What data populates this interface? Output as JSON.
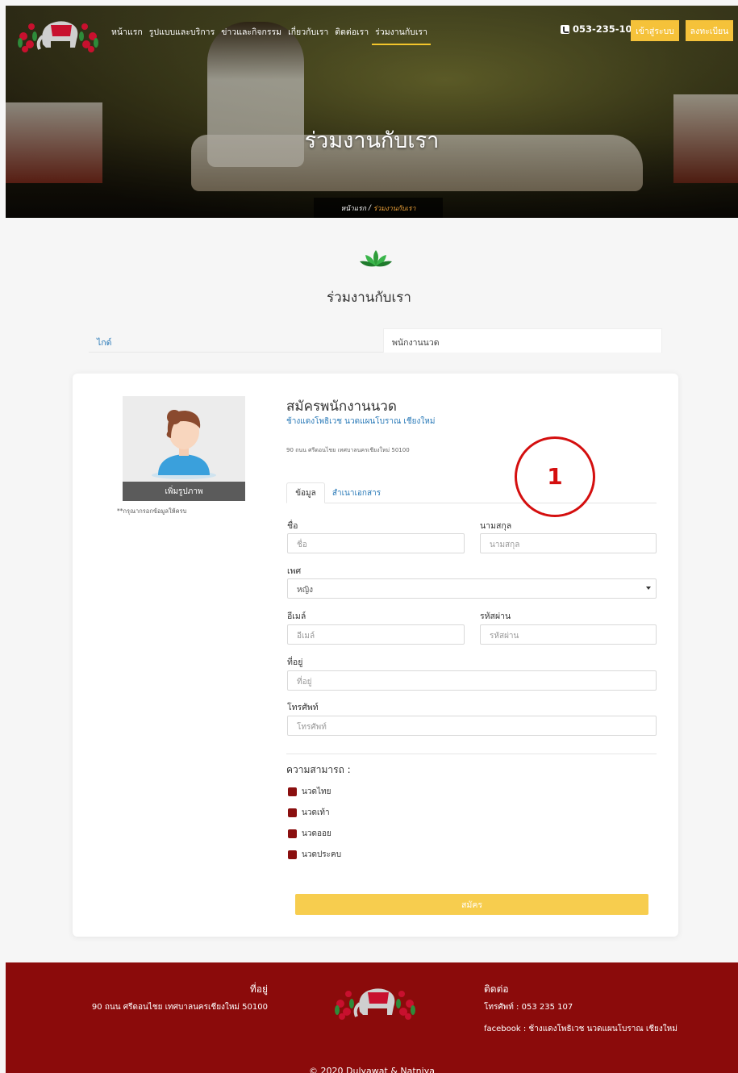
{
  "nav": {
    "menu": [
      "หน้าแรก",
      "รูปแบบและบริการ",
      "ข่าวและกิจกรรม",
      "เกี่ยวกับเรา",
      "ติดต่อเรา",
      "ร่วมงานกับเรา"
    ],
    "phone": "053-235-107",
    "login": "เข้าสู่ระบบ",
    "register": "ลงทะเบียน"
  },
  "hero": {
    "title": "ร่วมงานกับเรา",
    "crumb_home": "หน้าแรก",
    "crumb_sep": "/",
    "crumb_current": "ร่วมงานกับเรา"
  },
  "section": {
    "title": "ร่วมงานกับเรา",
    "filter_left": "ไกด์",
    "filter_right": "พนักงานนวด"
  },
  "form": {
    "add_photo": "เพิ่มรูปภาพ",
    "note": "**กรุณากรอกข้อมูลให้ครบ",
    "title": "สมัครพนักงานนวด",
    "subtitle": "ช้างแดงโพธิเวช นวดแผนโบราณ เชียงใหม่",
    "address": "90 ถนน ศรีดอนไชย เทศบาลนครเชียงใหม่ 50100",
    "tab_info": "ข้อมูล",
    "tab_docs": "สำเนาเอกสาร",
    "first_name_label": "ชื่อ",
    "first_name_ph": "ชื่อ",
    "last_name_label": "นามสกุล",
    "last_name_ph": "นามสกุล",
    "gender_label": "เพศ",
    "gender_value": "หญิง",
    "email_label": "อีเมล์",
    "email_ph": "อีเมล์",
    "password_label": "รหัสผ่าน",
    "password_ph": "รหัสผ่าน",
    "address_label": "ที่อยู่",
    "address_ph": "ที่อยู่",
    "phone_label": "โทรศัพท์",
    "phone_ph": "โทรศัพท์",
    "skills_label": "ความสามารถ :",
    "skills": [
      "นวดไทย",
      "นวดเท้า",
      "นวดออย",
      "นวดประคบ"
    ],
    "submit": "สมัคร"
  },
  "footer": {
    "address_head": "ที่อยู่",
    "address": "90 ถนน ศรีดอนไชย เทศบาลนครเชียงใหม่ 50100",
    "contact_head": "ติดต่อ",
    "tel": "โทรศัพท์ : 053 235 107",
    "facebook": "facebook : ช้างแดงโพธิเวช นวดแผนโบราณ เชียงใหม่",
    "copyright": "© 2020 Dulyawat & Natniya"
  },
  "annotation": {
    "number": "1"
  },
  "colors": {
    "accent": "#f5c23a",
    "brand": "#8b0b0b",
    "link": "#2a7ab8",
    "marker": "#d40f0f"
  }
}
